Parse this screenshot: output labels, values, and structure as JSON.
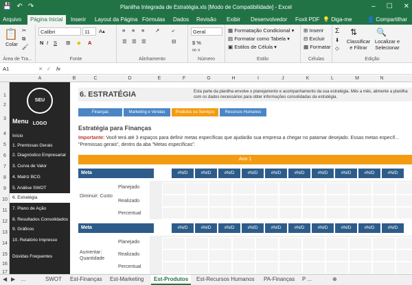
{
  "window": {
    "title": "Planilha Integrada de Estratégia.xls  [Modo de Compatibilidade] - Excel"
  },
  "menu_tabs": [
    "Arquivo",
    "Página Inicial",
    "Inserir",
    "Layout da Página",
    "Fórmulas",
    "Dados",
    "Revisão",
    "Exibir",
    "Desenvolvedor",
    "Foxit PDF"
  ],
  "tell_me": "Diga-me",
  "share": "Compartilhar",
  "ribbon": {
    "clipboard": {
      "paste": "Colar",
      "label": "Área de Tra..."
    },
    "font": {
      "name": "Calibri",
      "size": "11",
      "label": "Fonte"
    },
    "alignment": {
      "label": "Alinhamento"
    },
    "number": {
      "format": "Geral",
      "label": "Número"
    },
    "styles": {
      "cond": "Formatação Condicional",
      "table": "Formatar como Tabela",
      "cell": "Estilos de Célula",
      "label": "Estilo"
    },
    "cells": {
      "insert": "Inserir",
      "delete": "Excluir",
      "format": "Formatar",
      "label": "Células"
    },
    "editing": {
      "sort": "Classificar e Filtrar",
      "find": "Localizar e Selecionar",
      "label": "Edição"
    }
  },
  "formula_bar": {
    "name_box": "A1",
    "fx": "fx",
    "value": ""
  },
  "columns": [
    "A",
    "B",
    "C",
    "D",
    "E",
    "F",
    "G",
    "H",
    "I",
    "J",
    "K",
    "L",
    "M",
    "N"
  ],
  "rows": [
    "1",
    "2",
    "3",
    "4",
    "5",
    "6",
    "7",
    "8",
    "9",
    "10",
    "11",
    "12",
    "13",
    "14",
    "15",
    "16",
    "17"
  ],
  "sidebar": {
    "logo": "SEU LOGO",
    "menu_title": "Menu",
    "items": [
      "Início",
      "1. Premissas Gerais",
      "2. Diagnóstico Empresarial",
      "3. Curva de Valor",
      "4. Matriz BCG",
      "5. Análise SWOT",
      "6. Estratégia",
      "7. Plano de Ação",
      "8. Resultados Consolidados",
      "9. Gráficos",
      "10. Relatório Impresso",
      "Dúvidas Frequentes"
    ]
  },
  "content": {
    "page_title": "6. ESTRATÉGIA",
    "description": "Esta parte da planilha envolve o planejamento e acompanhamento da sua estratégia. Mês a mês, alimente a planilha com os dados necessários para obter informações consolidadas da estratégia.",
    "nav_tabs": [
      "Finanças",
      "Marketing e Vendas",
      "Produtos ou Serviços",
      "Recursos Humanos"
    ],
    "section_title": "Estratégia para Finanças",
    "important_label": "Importante:",
    "important_text": "Você terá até 3 espaços para definir metas específicas que ajudarão sua empresa a chegar no patamar desejado. Essas metas específ...",
    "important_text2": "\"Premissas gerais\", dentro da aba \"Metas específicas\".",
    "year_label": "Ano 1",
    "meta_label": "Meta",
    "nd": "#N/D",
    "meta1_name": "Diminuir: Custo",
    "meta2_name": "Aumentar: Quantidade",
    "sub_rows": [
      "Planejado",
      "Realizado",
      "Percentual"
    ]
  },
  "sheet_tabs": [
    "SWOT",
    "Est-Finanças",
    "Est-Marketing",
    "Est-Produtos",
    "Est-Recursos Humanos",
    "PA-Finanças",
    "P ..."
  ],
  "colors": {
    "excel_green": "#217346",
    "blue": "#4a86c5",
    "orange": "#f39c12",
    "dark": "#262626",
    "navy": "#2e5c8a"
  }
}
